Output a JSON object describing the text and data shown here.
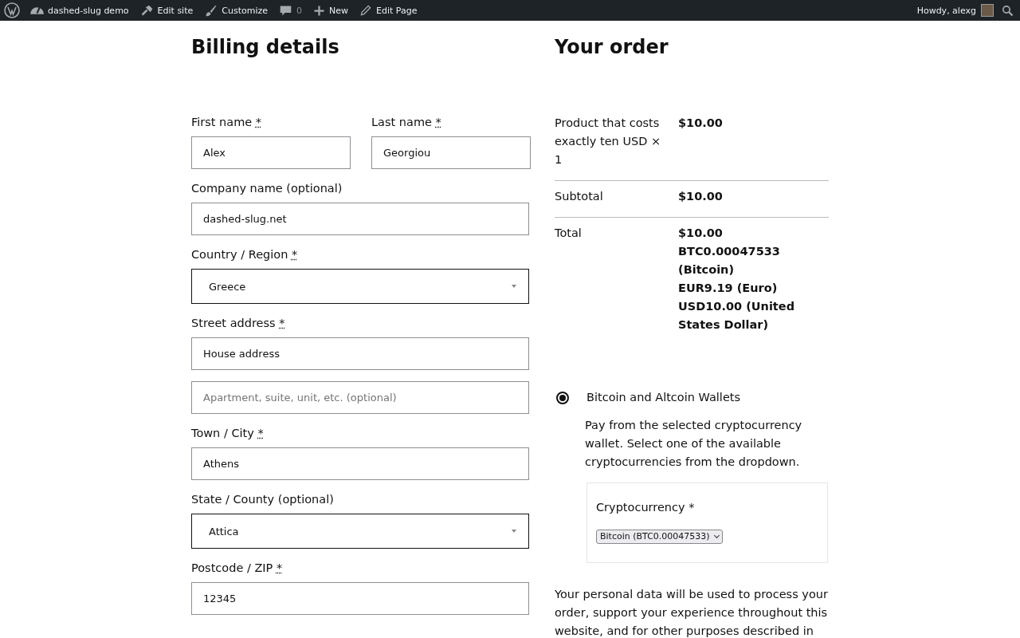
{
  "admin_bar": {
    "items": [
      {
        "kind": "logo"
      },
      {
        "kind": "dashboard",
        "label": "dashed-slug demo"
      },
      {
        "kind": "hammer",
        "label": "Edit site"
      },
      {
        "kind": "brush",
        "label": "Customize"
      },
      {
        "kind": "comments",
        "label": "0"
      },
      {
        "kind": "plus",
        "label": "New"
      },
      {
        "kind": "pencil",
        "label": "Edit Page"
      }
    ],
    "greeting": "Howdy, alexg"
  },
  "billing": {
    "title": "Billing details",
    "rows": [
      [
        {
          "label": "First name",
          "mark": "*",
          "kind": "text",
          "value": "Alex"
        },
        {
          "label": "Last name",
          "mark": "*",
          "kind": "text",
          "value": "Georgiou"
        }
      ],
      [
        {
          "label": "Company name (optional)",
          "kind": "text",
          "value": "dashed-slug.net"
        }
      ],
      [
        {
          "label": "Country / Region",
          "mark": "*",
          "kind": "select",
          "value": "Greece"
        }
      ],
      [
        {
          "label": "Street address",
          "mark": "*",
          "kind": "text",
          "value": "House address"
        }
      ],
      [
        {
          "kind": "text",
          "placeholder": "Apartment, suite, unit, etc. (optional)"
        }
      ],
      [
        {
          "label": "Town / City",
          "mark": "*",
          "kind": "text",
          "value": "Athens"
        }
      ],
      [
        {
          "label": "State / County (optional)",
          "kind": "select",
          "value": "Attica"
        }
      ],
      [
        {
          "label": "Postcode / ZIP",
          "mark": "*",
          "kind": "text",
          "value": "12345"
        }
      ]
    ]
  },
  "order": {
    "title": "Your order",
    "rows": [
      {
        "label": "Product that costs exactly ten USD × 1",
        "values": [
          "$10.00"
        ]
      },
      {
        "label": "Subtotal",
        "values": [
          "$10.00"
        ]
      },
      {
        "label": "Total",
        "values": [
          "$10.00",
          "BTC0.00047533 (Bitcoin)",
          "EUR9.19 (Euro)",
          "USD10.00 (United States Dollar)"
        ]
      }
    ],
    "payment": {
      "label": "Bitcoin and Altcoin Wallets",
      "selected": true,
      "description": "Pay from the selected cryptocurrency wallet. Select one of the available cryptocurrencies from the dropdown.",
      "field_label": "Cryptocurrency",
      "field_mark": "*",
      "dropdown": "Bitcoin (BTC0.00047533)"
    },
    "privacy": "Your personal data will be used to process your order, support your experience throughout this website, and for other purposes described in"
  }
}
